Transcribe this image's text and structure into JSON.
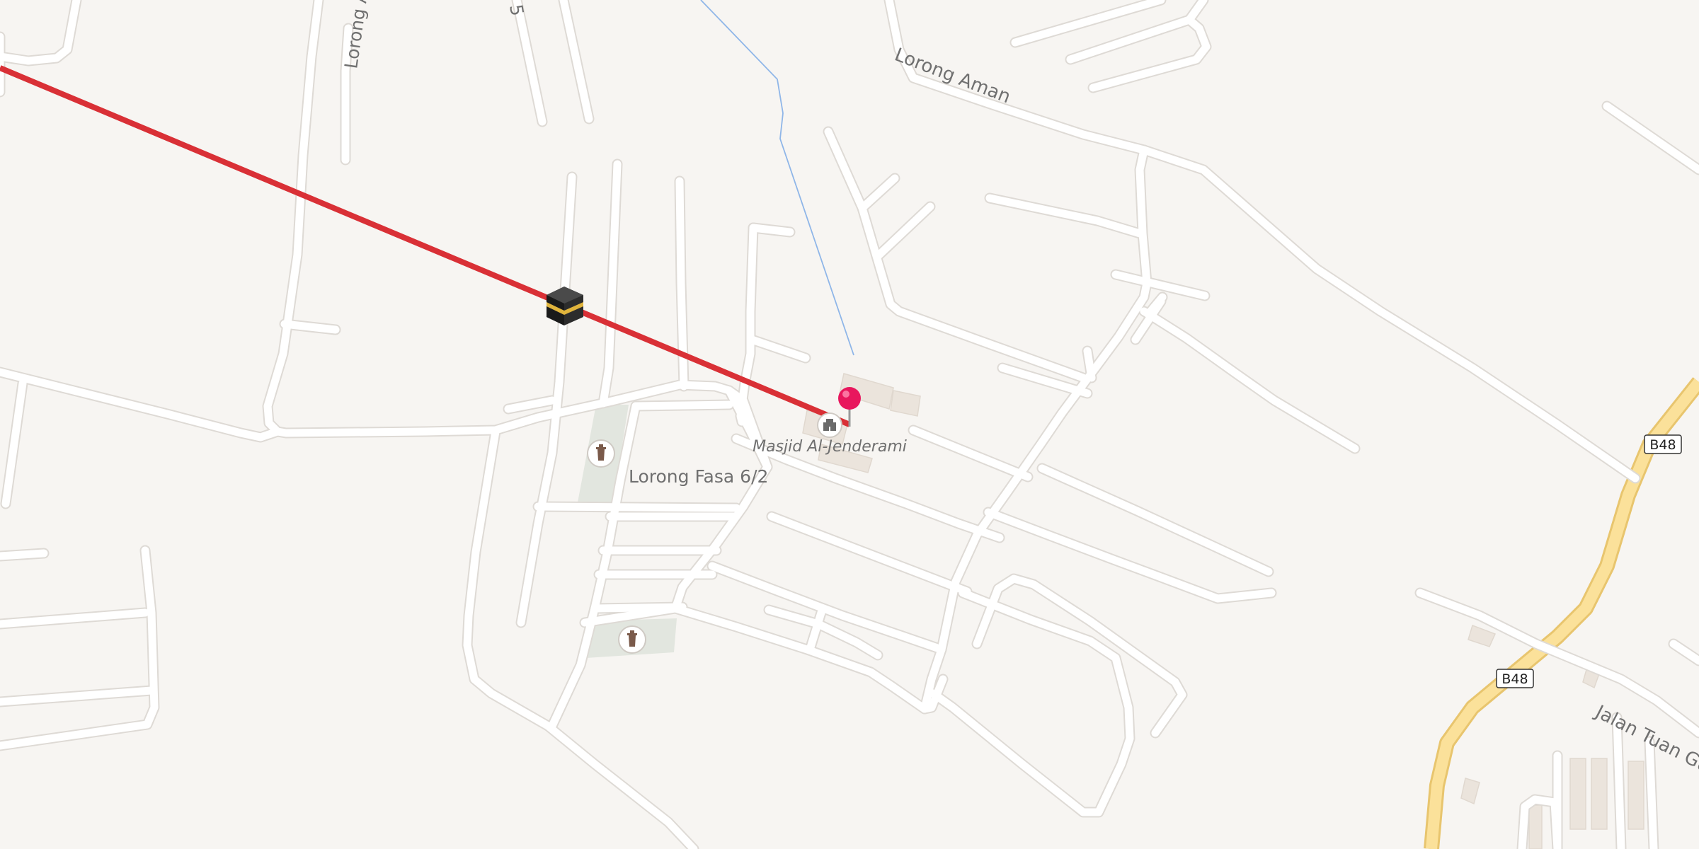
{
  "map": {
    "colors": {
      "land": "#f7f5f2",
      "road": "#ffffff",
      "road_edge": "#dedad5",
      "highway": "#fbe19a",
      "highway_edge": "#e8c56e",
      "route": "#d93036",
      "water": "#8fb6e8",
      "park": "#e2e6df",
      "building": "#ebe4dc",
      "pin": "#e8175d",
      "label": "#707070"
    },
    "street_labels": {
      "lorong_a_partial": "Lorong A",
      "lorong_5_partial": "5",
      "lorong_aman": "Lorong Aman",
      "lorong_fasa": "Lorong Fasa 6/2",
      "jalan_tuan_partial": "Jalan Tuan Gu"
    },
    "poi": {
      "mosque_name": "Masjid Al-Jenderami"
    },
    "route_shields": {
      "shield_1": "B48",
      "shield_2": "B48"
    },
    "icons": {
      "kaaba": "kaaba-icon",
      "location_pin": "location-pin-icon",
      "mosque": "mosque-icon",
      "cemetery": "cemetery-icon"
    }
  }
}
